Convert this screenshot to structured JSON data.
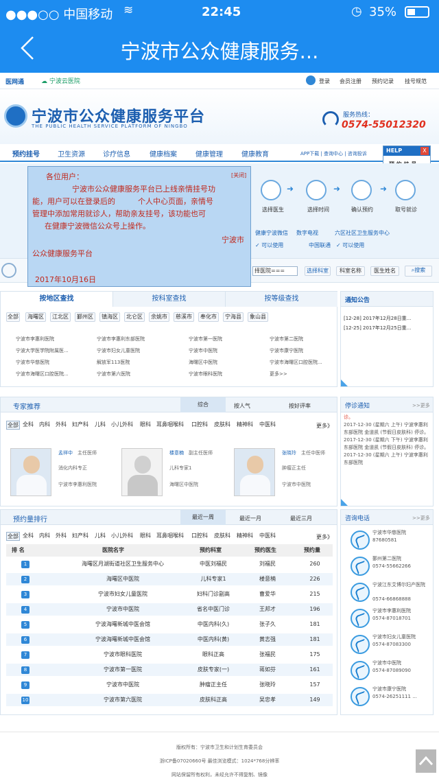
{
  "status": {
    "carrier": "●●●○○ 中国移动",
    "time": "22:45",
    "battery": "35%"
  },
  "nav": {
    "title": "宁波市公众健康服务..."
  },
  "site": {
    "logo_left": "医网通",
    "logo_left_sub": "宁波云医院",
    "top_links": [
      "登录",
      "会员注册",
      "预约记录",
      "挂号规范"
    ],
    "brand_title": "宁波市公众健康服务平台",
    "brand_en": "THE PUBLIC HEALTH SERVICE PLATFORM OF NINGBO",
    "hotline_label": "服务热线：",
    "hotline": "0574-55012320",
    "menu": [
      "预约挂号",
      "卫生资源",
      "诊疗信息",
      "健康档案",
      "健康管理",
      "健康教育"
    ],
    "menu_right": "APP下载 | 查询中心 | 咨询投诉",
    "help": "HELP",
    "help_close": "X",
    "help_sub": "预 约 挂 号",
    "steps": [
      "选择医生",
      "选择时间",
      "确认预约",
      "取号就诊"
    ],
    "channels": {
      "c1": "健康宁波微信",
      "c2": "数字电视",
      "c3": "六区社区卫生服务中心",
      "available1": "✓ 可以使用",
      "c4": "中国联通",
      "available2": "✓ 可以使用"
    },
    "search": {
      "select": "择医院===",
      "btn1": "选择科室",
      "btn2": "科室名称",
      "btn3": "医生姓名",
      "btn4": "搜索"
    }
  },
  "popup": {
    "greeting": "各位用户：",
    "close": "[关闭]",
    "body1": "宁波市公众健康服务平台已上线亲情挂号功",
    "body2": "能，用户可以在登录后的　　　个人中心页面，亲情号",
    "body3": "管理中添加常用就诊人，帮助亲友挂号，该功能也可",
    "body4": "在健康宁波微信公众号上操作。",
    "sign1": "宁波市",
    "sign2": "公众健康服务平台",
    "date": "2017年10月16日"
  },
  "area": {
    "tabs": [
      "按地区查找",
      "按科室查找",
      "按等级查找"
    ],
    "districts": [
      "全部",
      "海曙区",
      "江北区",
      "鄞州区",
      "镇海区",
      "北仑区",
      "余姚市",
      "慈溪市",
      "奉化市",
      "宁海县",
      "象山县"
    ],
    "hospitals": [
      [
        "宁波市李惠利医院",
        "宁波市李惠利东部医院",
        "宁波市第一医院",
        "宁波市第二医院"
      ],
      [
        "宁波大学医学院附属医...",
        "宁波市妇女儿童医院",
        "宁波市中医院",
        "宁波市康宁医院"
      ],
      [
        "宁波市华慈医院",
        "解放军113医院",
        "海曙区中医院",
        "宁波市海曙区口腔医院..."
      ],
      [
        "宁波市海曙区口腔医院...",
        "宁波市第六医院",
        "宁波市眼科医院",
        "更多>>"
      ]
    ]
  },
  "notice": {
    "title": "通知公告",
    "items": [
      "[12-28]  2017年12月28日重...",
      "[12-25]  2017年12月25日重..."
    ]
  },
  "experts": {
    "title": "专家推荐",
    "sort_tabs": [
      "综合",
      "按人气",
      "按好评率"
    ],
    "depts": [
      "全部",
      "全科",
      "内科",
      "外科",
      "妇产科",
      "儿科",
      "小儿外科",
      "眼科",
      "耳鼻咽喉科",
      "口腔科",
      "皮肤科",
      "精神科",
      "中医科"
    ],
    "more": "更多》",
    "cards": [
      {
        "name": "孟祥中",
        "title": "主任医师",
        "spec": "消化内科专正",
        "hosp": "宁波市李惠利医院"
      },
      {
        "name": "楼意楠",
        "title": "副主任医师",
        "spec": "儿科专家1",
        "hosp": "海曙区中医院"
      },
      {
        "name": "张晓玲",
        "title": "主任中医师",
        "spec": "肿瘤正主任",
        "hosp": "宁波市中医院"
      }
    ]
  },
  "stop": {
    "title": "停诊通知",
    "more": ">>更多",
    "items": [
      "诊。",
      "2017-12-30 (星期六 上午) 宁波李惠利东部医院 金道凯 (节假日皮肤科) 停诊。",
      "2017-12-30 (星期六 下午) 宁波李惠利东部医院 金道凯 (节假日皮肤科) 停诊。",
      "2017-12-30 (星期六 上午) 宁波李惠利东部医院"
    ]
  },
  "rank": {
    "title": "预约量排行",
    "tabs": [
      "最近一周",
      "最近一月",
      "最近三月"
    ],
    "depts": [
      "全部",
      "全科",
      "内科",
      "外科",
      "妇产科",
      "儿科",
      "小儿外科",
      "眼科",
      "耳鼻咽喉科",
      "口腔科",
      "皮肤科",
      "精神科",
      "中医科"
    ],
    "more": "更多》",
    "headers": [
      "排 名",
      "医院名字",
      "预约科室",
      "预约医生",
      "预约量"
    ],
    "rows": [
      [
        "1",
        "海曙区月湖街道社区卫生服务中心",
        "中医刘福民",
        "刘福民",
        "260"
      ],
      [
        "2",
        "海曙区中医院",
        "儿科专家1",
        "楼意楠",
        "226"
      ],
      [
        "3",
        "宁波市妇女儿童医院",
        "妇科门诊副高",
        "曹爱华",
        "215"
      ],
      [
        "4",
        "宁波市中医院",
        "省名中医门诊",
        "王邦才",
        "196"
      ],
      [
        "5",
        "宁波海曙新城中医会馆",
        "中医内科(久)",
        "张子久",
        "181"
      ],
      [
        "6",
        "宁波海曙新城中医会馆",
        "中医内科(黄)",
        "黄志强",
        "181"
      ],
      [
        "7",
        "宁波市眼科医院",
        "眼科正高",
        "张福民",
        "175"
      ],
      [
        "8",
        "宁波市第一医院",
        "皮肤专家(一)",
        "蒋如芬",
        "161"
      ],
      [
        "9",
        "宁波市中医院",
        "肿瘤正主任",
        "张晓玲",
        "157"
      ],
      [
        "10",
        "宁波市第六医院",
        "皮肤科正高",
        "吴忠孝",
        "149"
      ]
    ]
  },
  "consult": {
    "title": "咨询电话",
    "more": ">>更多",
    "items": [
      {
        "name": "宁波市华慈医院",
        "phone": "87680581"
      },
      {
        "name": "鄞州第二医院",
        "phone": "0574-55662266"
      },
      {
        "name": "宁波江东艾博尔妇产医院",
        "phone": "0574-66868888"
      },
      {
        "name": "宁波市李惠利医院",
        "phone": "0574-87018701"
      },
      {
        "name": "宁波市妇女儿童医院",
        "phone": "0574-87083300"
      },
      {
        "name": "宁波市中医院",
        "phone": "0574-87089090"
      },
      {
        "name": "宁波市康宁医院",
        "phone": "0574-26251111 ..."
      }
    ]
  },
  "footer": {
    "l1": "版权所有：宁波市卫生和计划生育委员会",
    "l2": "浙ICP备07020660号 最佳浏览模式：1024*768分辨率",
    "l3": "网站保留所有权利，未经允许不得复制、镜像"
  }
}
